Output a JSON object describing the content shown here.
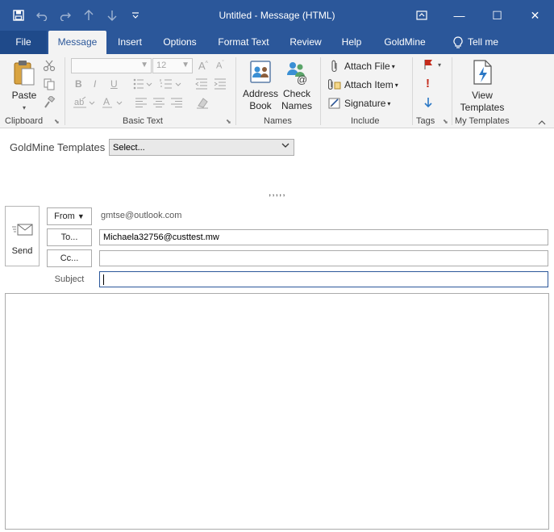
{
  "titlebar": {
    "title": "Untitled  -  Message (HTML)",
    "save_icon": "save-icon",
    "undo_icon": "undo-icon",
    "redo_icon": "redo-icon",
    "up_icon": "arrow-up-icon",
    "down_icon": "arrow-down-icon",
    "customize_icon": "customize-qat-icon",
    "ribbon_display_icon": "ribbon-display-icon",
    "minimize": "—",
    "maximize": "☐",
    "close": "✕"
  },
  "tabs": [
    {
      "label": "File"
    },
    {
      "label": "Message"
    },
    {
      "label": "Insert"
    },
    {
      "label": "Options"
    },
    {
      "label": "Format Text"
    },
    {
      "label": "Review"
    },
    {
      "label": "Help"
    },
    {
      "label": "GoldMine"
    },
    {
      "label": "Tell me"
    }
  ],
  "ribbon": {
    "clipboard": {
      "label": "Clipboard",
      "paste": "Paste"
    },
    "basic_text": {
      "label": "Basic Text",
      "font_size": "12"
    },
    "names": {
      "label": "Names",
      "address_book_1": "Address",
      "address_book_2": "Book",
      "check_names_1": "Check",
      "check_names_2": "Names"
    },
    "include": {
      "label": "Include",
      "attach_file": "Attach File",
      "attach_item": "Attach Item",
      "signature": "Signature"
    },
    "tags": {
      "label": "Tags"
    },
    "my_templates": {
      "label": "My Templates",
      "view_1": "View",
      "view_2": "Templates"
    }
  },
  "templates_bar": {
    "label": "GoldMine Templates",
    "selected": "Select..."
  },
  "dots": ",,,,,",
  "compose": {
    "send": "Send",
    "from_button": "From",
    "from_value": "gmtse@outlook.com",
    "to_button": "To...",
    "to_value": "Michaela32756@custtest.mw",
    "cc_button": "Cc...",
    "cc_value": "",
    "subject_label": "Subject",
    "subject_value": ""
  },
  "colors": {
    "accent": "#2b579a",
    "ribbon_bg": "#f3f3f3",
    "flag_red": "#c42b1c"
  }
}
